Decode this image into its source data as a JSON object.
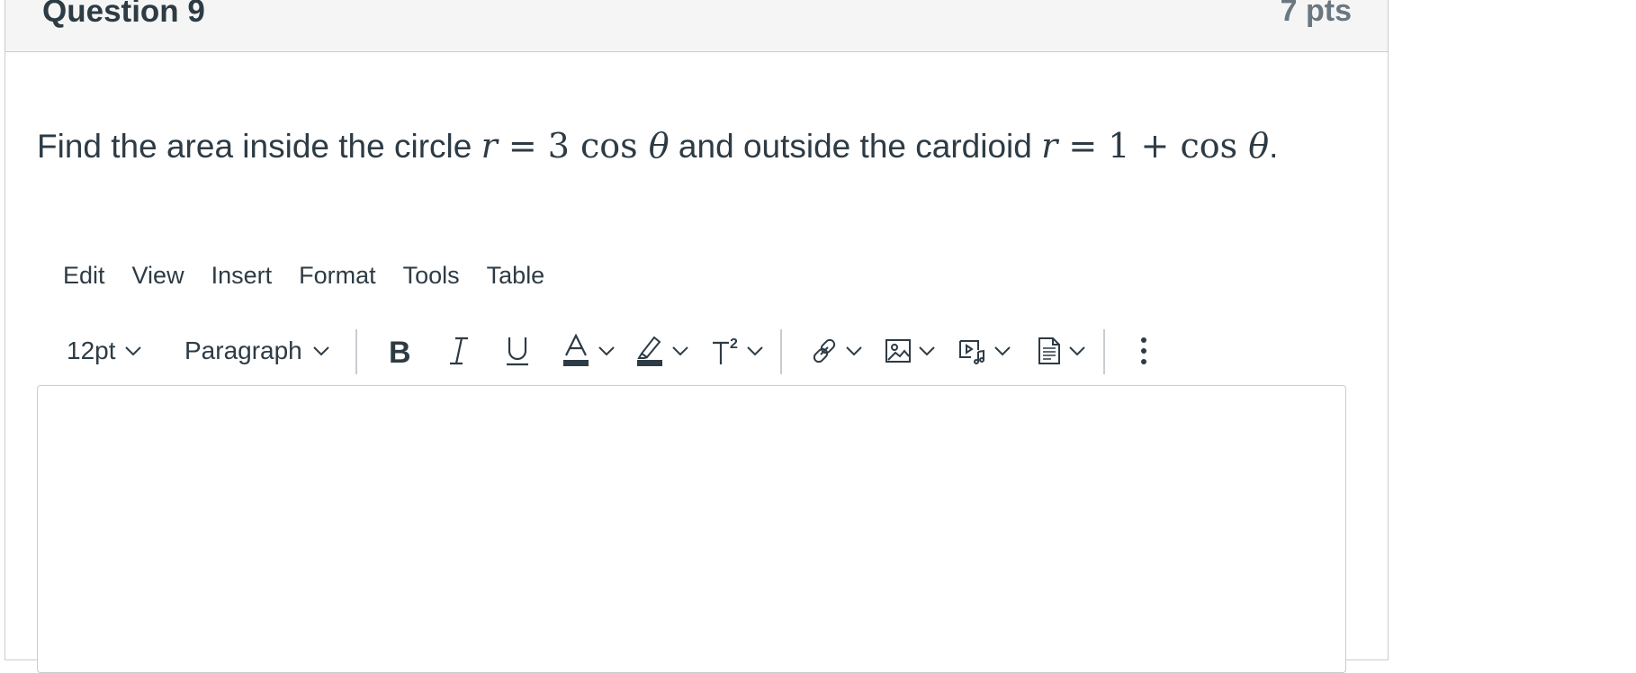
{
  "question": {
    "title": "Question 9",
    "points": "7 pts",
    "text_parts": {
      "p1": "Find the area inside the circle ",
      "math1": "r = 3 cos θ",
      "p2": " and outside the cardioid ",
      "math2": "r = 1 + cos θ",
      "p3": "."
    }
  },
  "menubar": {
    "items": [
      "Edit",
      "View",
      "Insert",
      "Format",
      "Tools",
      "Table"
    ]
  },
  "toolbar": {
    "font_size": "12pt",
    "block_format": "Paragraph",
    "text_color_accent": "#2d3b45",
    "icons": [
      "bold-icon",
      "italic-icon",
      "underline-icon",
      "text-color-icon",
      "highlight-icon",
      "superscript-icon",
      "link-icon",
      "image-icon",
      "media-icon",
      "document-icon",
      "more-options-icon"
    ]
  },
  "editor": {
    "content": ""
  }
}
